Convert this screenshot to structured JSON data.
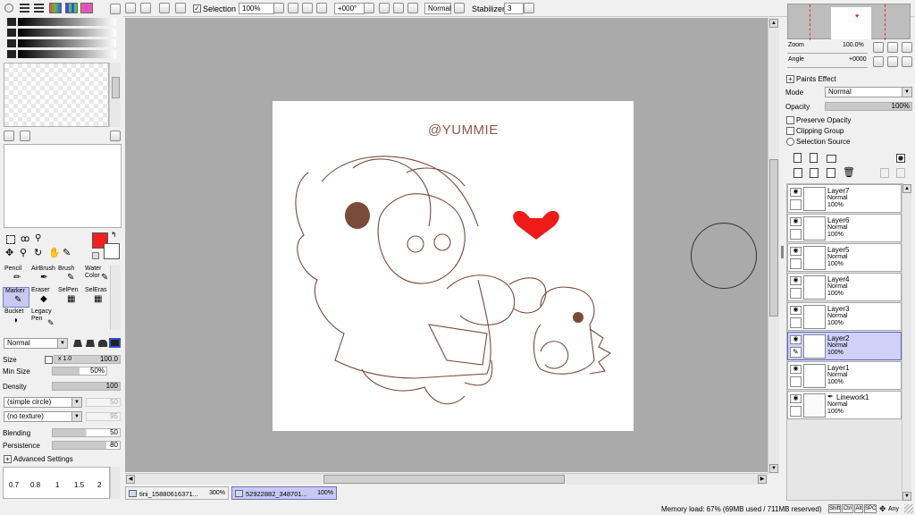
{
  "toolbar": {
    "selection_label": "Selection",
    "zoom_value": "100%",
    "rotation_value": "+000°",
    "blend_value": "Normal",
    "stabilizer_label": "Stabilizer",
    "stabilizer_value": "3"
  },
  "tool_settings": {
    "tools": [
      "Pencil",
      "AirBrush",
      "Brush",
      "Water Color",
      "Marker",
      "Eraser",
      "SelPen",
      "SelEras",
      "Bucket",
      "Legacy Pen"
    ],
    "mode": "Normal",
    "size_label": "Size",
    "size_mult": "x 1.0",
    "size_value": "100.0",
    "min_size_label": "Min Size",
    "min_size_value": "50%",
    "density_label": "Density",
    "density_value": "100",
    "shape": "(simple circle)",
    "shape_value": "50",
    "texture": "(no texture)",
    "texture_value": "95",
    "blending_label": "Blending",
    "blending_value": "50",
    "persistence_label": "Persistence",
    "persistence_value": "80",
    "advanced_label": "Advanced Settings",
    "brush_sizes": [
      "0.7",
      "0.8",
      "1",
      "1.5",
      "2"
    ]
  },
  "canvas": {
    "watermark": "@YUMMIE"
  },
  "navigator": {
    "zoom_label": "Zoom",
    "zoom_value": "100.0%",
    "angle_label": "Angle",
    "angle_value": "+0000"
  },
  "layer_props": {
    "paints_effect": "Paints Effect",
    "mode_label": "Mode",
    "mode_value": "Normal",
    "opacity_label": "Opacity",
    "opacity_value": "100%",
    "preserve_opacity": "Preserve Opacity",
    "clipping_group": "Clipping Group",
    "selection_source": "Selection Source"
  },
  "layers": [
    {
      "name": "Layer7",
      "mode": "Normal",
      "opacity": "100%"
    },
    {
      "name": "Layer6",
      "mode": "Normal",
      "opacity": "100%"
    },
    {
      "name": "Layer5",
      "mode": "Normal",
      "opacity": "100%"
    },
    {
      "name": "Layer4",
      "mode": "Normal",
      "opacity": "100%"
    },
    {
      "name": "Layer3",
      "mode": "Normal",
      "opacity": "100%"
    },
    {
      "name": "Layer2",
      "mode": "Normal",
      "opacity": "100%"
    },
    {
      "name": "Layer1",
      "mode": "Normal",
      "opacity": "100%"
    },
    {
      "name": "Linework1",
      "mode": "Normal",
      "opacity": "100%"
    }
  ],
  "tabs": [
    {
      "title": "tini_15880616371...",
      "zoom": "300%"
    },
    {
      "title": "52922882_348701...",
      "zoom": "100%"
    }
  ],
  "status": {
    "memory": "Memory load: 67% (69MB used / 711MB reserved)",
    "keys": [
      "Shift",
      "Ctrl",
      "Alt",
      "SPC"
    ],
    "any_label": "Any"
  },
  "colors": {
    "primary": "#f02020",
    "secondary": "#ffffff",
    "heart": "#ee1b1b",
    "line": "#7a4a3a"
  }
}
